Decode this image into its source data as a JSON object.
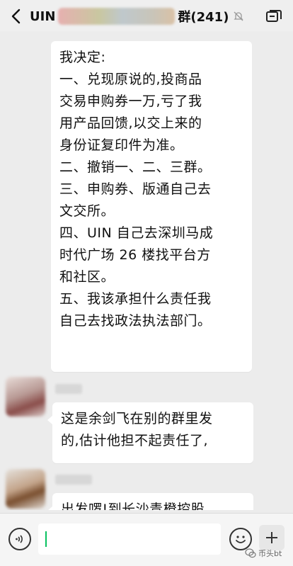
{
  "header": {
    "title_prefix": "UIN",
    "title_suffix": "群(241)",
    "icons": {
      "back": "back-arrow-icon",
      "mute": "mute-bell-icon",
      "menu": "chat-info-icon"
    }
  },
  "messages": [
    {
      "lines": [
        "我决定:",
        "一、兑现原说的,投商品",
        "交易申购券一万,亏了我",
        "用产品回馈,以交上来的",
        "身份证复印件为准。",
        "二、撤销一、二、三群。",
        "三、申购券、版通自己去",
        "文交所。",
        "四、UIN 自己去深圳马成",
        "时代广场 26 楼找平台方",
        "和社区。",
        "五、我该承担什么责任我",
        "自己去找政法执法部门。"
      ]
    },
    {
      "lines": [
        "这是余剑飞在别的群里发",
        "的,估计他担不起责任了,"
      ]
    },
    {
      "lines": [
        "出发啰!到长沙青橙控股"
      ]
    }
  ],
  "inputbar": {
    "icons": {
      "voice": "voice-icon",
      "emoji": "emoji-icon",
      "more": "plus-icon"
    }
  },
  "watermark": {
    "text": "币头bt"
  }
}
